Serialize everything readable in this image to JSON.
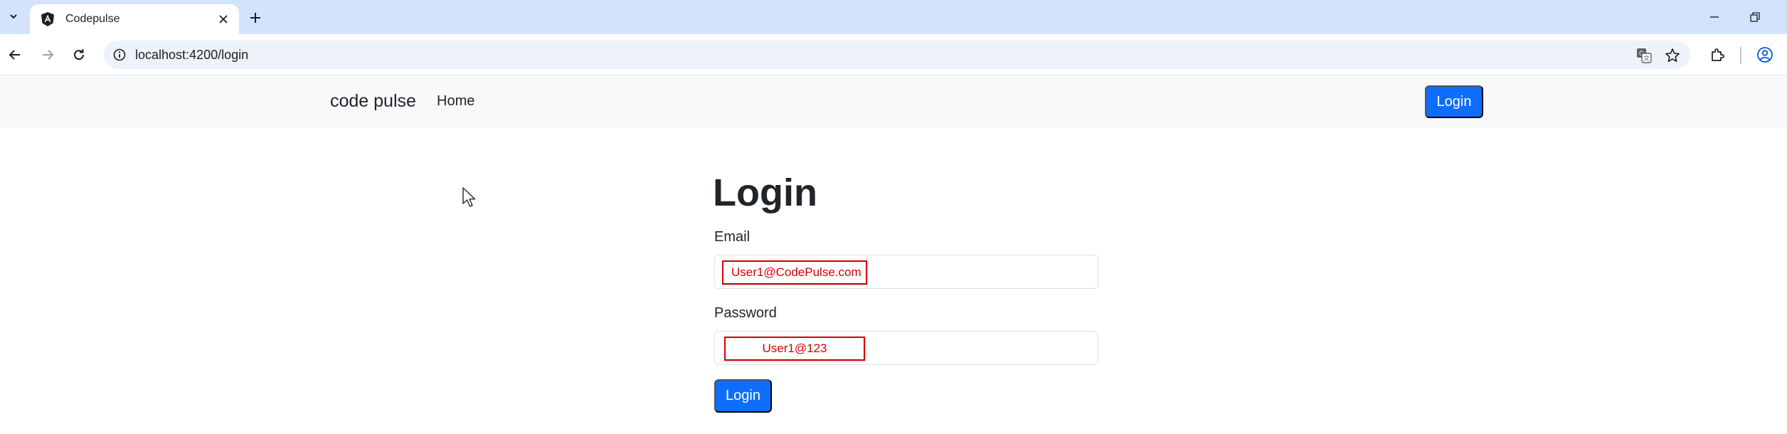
{
  "browser": {
    "tab": {
      "title": "Codepulse"
    },
    "address_bar": {
      "url": "localhost:4200/login"
    }
  },
  "site": {
    "brand": "code pulse",
    "nav": {
      "home_label": "Home",
      "login_label": "Login"
    }
  },
  "login_form": {
    "heading": "Login",
    "email": {
      "label": "Email",
      "value": "User1@CodePulse.com"
    },
    "password": {
      "label": "Password",
      "value": "User1@123"
    },
    "submit_label": "Login"
  },
  "colors": {
    "primary": "#0d6efd",
    "navbar_bg": "#f8f9fa",
    "tabstrip_bg": "#d3e3fd",
    "highlight_red": "#d40000"
  }
}
